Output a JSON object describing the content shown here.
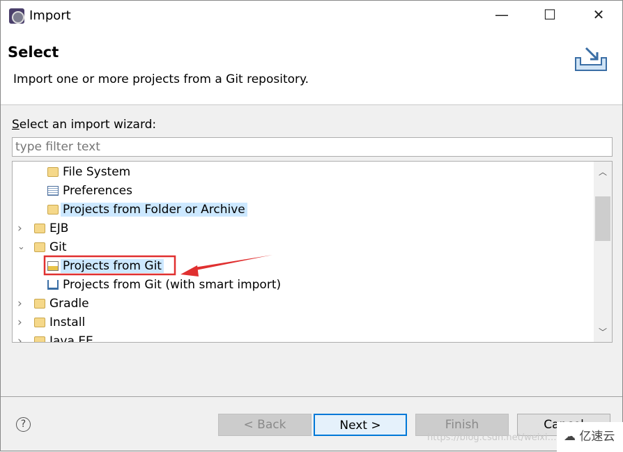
{
  "window": {
    "title": "Import",
    "minimize": "—",
    "maximize": "☐",
    "close": "✕"
  },
  "header": {
    "title": "Select",
    "subtitle": "Import one or more projects from a Git repository."
  },
  "wizard": {
    "label_accesskey": "S",
    "label_rest": "elect an import wizard:",
    "filter_placeholder": "type filter text",
    "filter_value": ""
  },
  "tree": [
    {
      "label": "File System",
      "depth": 2,
      "icon": "folder-icon"
    },
    {
      "label": "Preferences",
      "depth": 2,
      "icon": "preferences-icon"
    },
    {
      "label": "Projects from Folder or Archive",
      "depth": 2,
      "icon": "folder-icon",
      "highlighted": true
    },
    {
      "label": "EJB",
      "depth": 1,
      "icon": "folder-open-icon",
      "expanded": false
    },
    {
      "label": "Git",
      "depth": 1,
      "icon": "folder-open-icon",
      "expanded": true
    },
    {
      "label": "Projects from Git",
      "depth": 2,
      "icon": "git-icon",
      "selected": true,
      "annotated": true
    },
    {
      "label": "Projects from Git (with smart import)",
      "depth": 2,
      "icon": "smart-import-icon"
    },
    {
      "label": "Gradle",
      "depth": 1,
      "icon": "folder-open-icon",
      "expanded": false
    },
    {
      "label": "Install",
      "depth": 1,
      "icon": "folder-open-icon",
      "expanded": false
    },
    {
      "label": "Java EE",
      "depth": 1,
      "icon": "folder-open-icon",
      "expanded": false
    }
  ],
  "buttons": {
    "back": "< Back",
    "next": "Next >",
    "finish": "Finish",
    "cancel": "Cancel"
  },
  "watermark": {
    "text": "https://blog.csdn.net/weixi…",
    "logo": "亿速云"
  },
  "colors": {
    "annotation": "#e03030",
    "selection": "#cce8ff",
    "default_button_border": "#0078d7"
  }
}
